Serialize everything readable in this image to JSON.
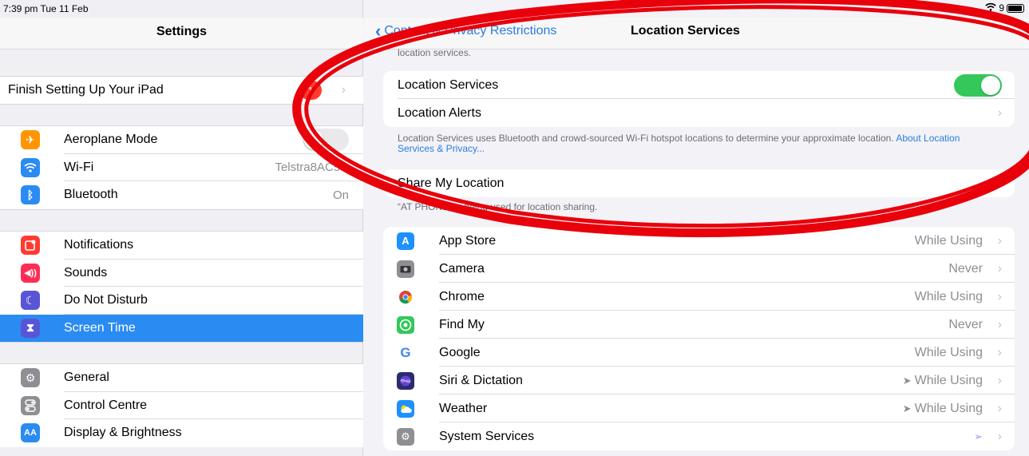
{
  "status": {
    "time": "7:39 pm  Tue 11 Feb",
    "battery": "9"
  },
  "sidebar": {
    "title": "Settings",
    "finish": {
      "label": "Finish Setting Up Your iPad",
      "badge": "1"
    },
    "group1": [
      {
        "label": "Aeroplane Mode",
        "icon": "airplane-icon",
        "color": "#ff9500"
      },
      {
        "label": "Wi-Fi",
        "value": "Telstra8AC5C",
        "icon": "wifi-icon",
        "color": "#2a8bf2"
      },
      {
        "label": "Bluetooth",
        "value": "On",
        "icon": "bluetooth-icon",
        "color": "#2a8bf2"
      }
    ],
    "group2": [
      {
        "label": "Notifications",
        "icon": "notifications-icon",
        "color": "#ff3b30"
      },
      {
        "label": "Sounds",
        "icon": "speaker-icon",
        "color": "#ff2d55"
      },
      {
        "label": "Do Not Disturb",
        "icon": "moon-icon",
        "color": "#5856d6"
      },
      {
        "label": "Screen Time",
        "icon": "hourglass-icon",
        "color": "#5856d6",
        "selected": true
      }
    ],
    "group3": [
      {
        "label": "General",
        "icon": "gear-icon",
        "color": "#8e8e93"
      },
      {
        "label": "Control Centre",
        "icon": "switches-icon",
        "color": "#8e8e93"
      },
      {
        "label": "Display & Brightness",
        "icon": "display-icon",
        "color": "#2a8bf2"
      }
    ]
  },
  "main": {
    "back_label": "Content & Privacy Restrictions",
    "title": "Location Services",
    "top_caption": "location services.",
    "location_services": "Location Services",
    "location_alerts": "Location Alerts",
    "caption1_text": "Location Services uses Bluetooth and crowd-sourced Wi-Fi hotspot locations to determine your approximate location.",
    "caption1_link": "About Location Services & Privacy...",
    "share_my_location": "Share My Location",
    "caption2": "“AT PHONE” is being used for location sharing.",
    "apps": [
      {
        "name": "App Store",
        "value": "While Using",
        "icon": "app-store-icon",
        "color": "#1e90ff"
      },
      {
        "name": "Camera",
        "value": "Never",
        "icon": "camera-icon",
        "color": "#8e8e93"
      },
      {
        "name": "Chrome",
        "value": "While Using",
        "icon": "chrome-icon",
        "color": "#ffffff"
      },
      {
        "name": "Find My",
        "value": "Never",
        "icon": "find-my-icon",
        "color": "#34c759"
      },
      {
        "name": "Google",
        "value": "While Using",
        "icon": "google-icon",
        "color": "#ffffff"
      },
      {
        "name": "Siri & Dictation",
        "value": "While Using",
        "icon": "siri-icon",
        "color": "#2b2b6e",
        "arrow": true
      },
      {
        "name": "Weather",
        "value": "While Using",
        "icon": "weather-icon",
        "color": "#1e90ff",
        "arrow": true
      },
      {
        "name": "System Services",
        "value": "",
        "icon": "gear-icon",
        "color": "#8e8e93",
        "arrow": true,
        "arrow_purple": true
      }
    ]
  },
  "colors": {
    "accent": "#2a7de1",
    "toggle_on": "#34c759",
    "badge": "#ff3b30",
    "annotation": "#e8000b"
  }
}
